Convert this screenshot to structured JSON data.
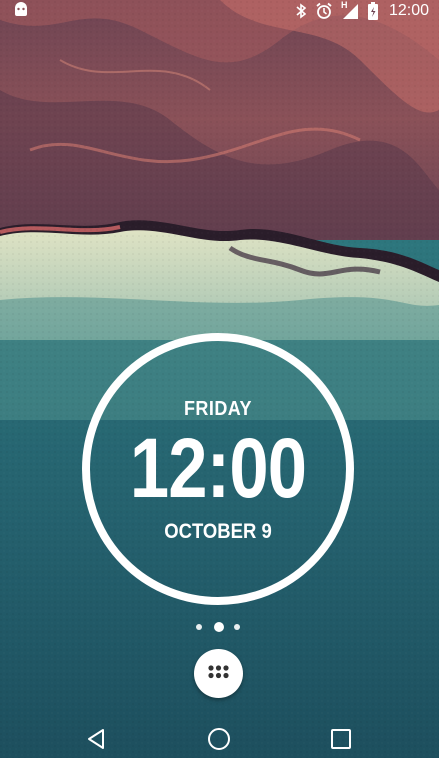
{
  "status_bar": {
    "time": "12:00",
    "network_type": "H",
    "icons": [
      "android-notification-icon",
      "bluetooth-icon",
      "alarm-icon",
      "signal-icon",
      "battery-icon"
    ]
  },
  "clock_widget": {
    "day": "FRIDAY",
    "time": "12:00",
    "date": "OCTOBER 9"
  },
  "home_pages": {
    "count": 3,
    "current": 2
  },
  "dock": {
    "app_drawer_icon": "app-drawer-icon"
  },
  "nav_bar": {
    "buttons": [
      "back-icon",
      "home-icon",
      "recents-icon"
    ]
  },
  "colors": {
    "sky_top": "#7a4a56",
    "shore": "#e8ead0",
    "sea": "#2a6b76",
    "white": "#ffffff"
  }
}
